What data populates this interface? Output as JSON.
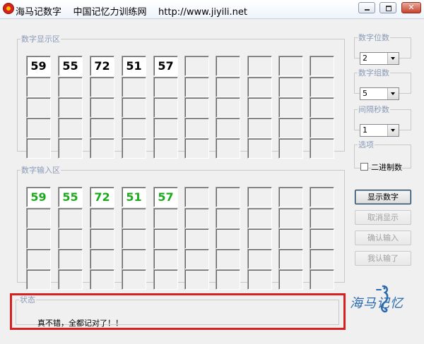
{
  "titlebar": {
    "title": "海马记数字    中国记忆力训练网    http://www.jiyili.net"
  },
  "display_area": {
    "legend": "数字显示区",
    "cells": [
      "59",
      "55",
      "72",
      "51",
      "57"
    ]
  },
  "input_area": {
    "legend": "数字输入区",
    "cells": [
      "59",
      "55",
      "72",
      "51",
      "57"
    ]
  },
  "settings": {
    "digits": {
      "label": "数字位数",
      "value": "2"
    },
    "groups": {
      "label": "数字组数",
      "value": "5"
    },
    "interval": {
      "label": "间隔秒数",
      "value": "1"
    },
    "options": {
      "label": "选项",
      "binary_label": "二进制数",
      "binary_checked": false
    }
  },
  "buttons": {
    "show": "显示数字",
    "cancel": "取消显示",
    "confirm": "确认输入",
    "give_up": "我认输了"
  },
  "status": {
    "legend": "状态",
    "message": "真不错，全都记对了！！"
  },
  "logo": {
    "text": "海马记忆"
  },
  "colors": {
    "correct": "#1cab1c",
    "status_border": "#d82020"
  }
}
